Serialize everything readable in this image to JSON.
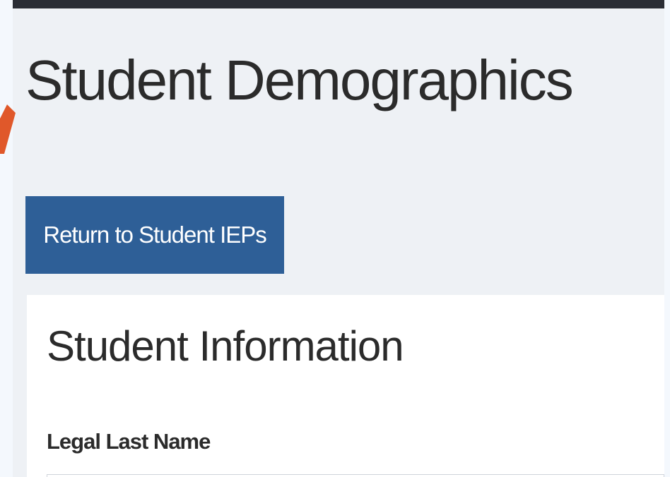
{
  "page": {
    "title": "Student Demographics"
  },
  "actions": {
    "return_label": "Return to Student IEPs"
  },
  "student_info": {
    "section_title": "Student Information",
    "fields": [
      {
        "label": "Legal Last Name",
        "value": ""
      }
    ]
  },
  "colors": {
    "topbar": "#2a2d35",
    "page_background": "#eef1f5",
    "primary_button": "#2e5f97",
    "annotation_arrow": "#e0582a"
  },
  "icons": {
    "annotation": "orange-arrow-icon"
  }
}
